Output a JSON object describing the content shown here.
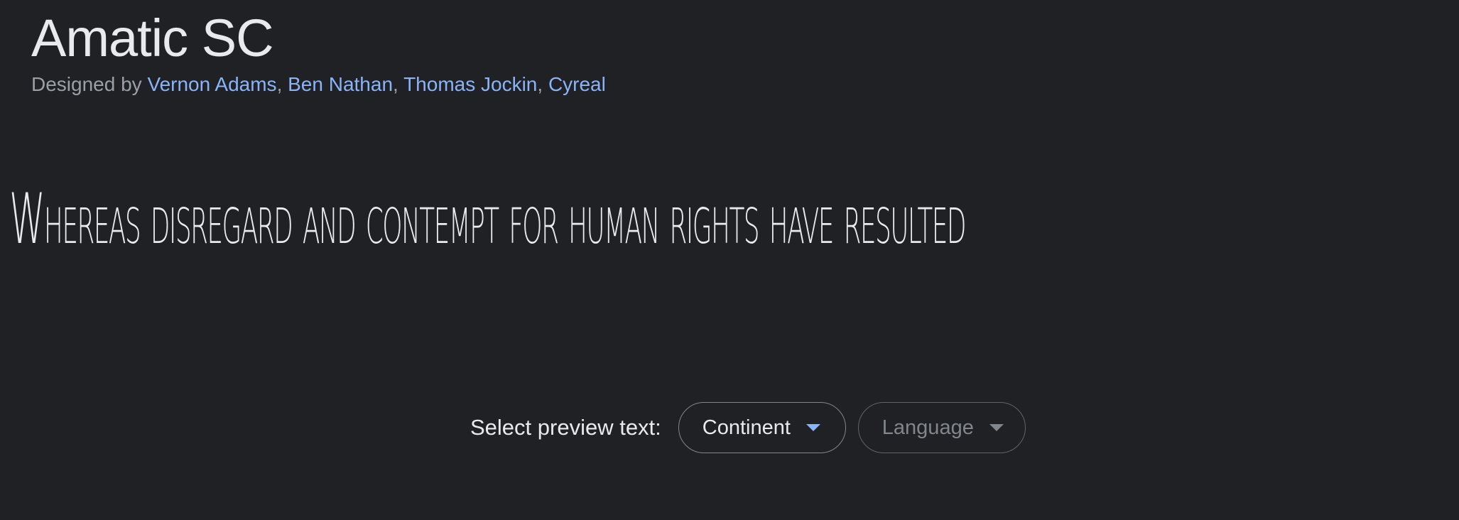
{
  "font": {
    "name": "Amatic SC",
    "designed_by_prefix": "Designed by",
    "designers": [
      "Vernon Adams",
      "Ben Nathan",
      "Thomas Jockin",
      "Cyreal"
    ]
  },
  "preview": {
    "text": "Whereas disregard and contempt for human rights have resulted"
  },
  "controls": {
    "label": "Select preview text:",
    "continent_select": {
      "value": "Continent",
      "icon": "caret-down-icon"
    },
    "language_select": {
      "value": "Language",
      "icon": "caret-down-icon",
      "disabled": true
    }
  },
  "colors": {
    "background": "#202124",
    "text": "#e8eaed",
    "link": "#8ab4f8",
    "muted": "#9aa0a6"
  }
}
